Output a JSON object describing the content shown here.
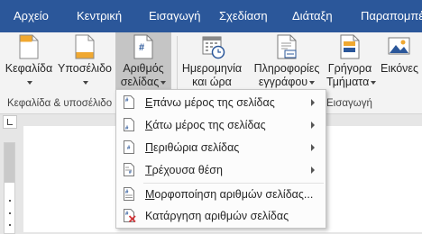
{
  "tabs": [
    {
      "label": "Αρχείο"
    },
    {
      "label": "Κεντρική"
    },
    {
      "label": "Εισαγωγή"
    },
    {
      "label": "Σχεδίαση"
    },
    {
      "label": "Διάταξη"
    },
    {
      "label": "Παραπομπές"
    }
  ],
  "ribbon": {
    "header": {
      "line1": "Κεφαλίδα"
    },
    "footer": {
      "line1": "Υποσέλιδο"
    },
    "page_number": {
      "line1": "Αριθμός",
      "line2": "σελίδας"
    },
    "date_time": {
      "line1": "Ημερομηνία",
      "line2": "και ώρα"
    },
    "doc_info": {
      "line1": "Πληροφορίες",
      "line2": "εγγράφου"
    },
    "quick_parts": {
      "line1": "Γρήγορα",
      "line2": "Τμήματα"
    },
    "pictures": {
      "line1": "Εικόνες"
    },
    "group_header_footer": "Κεφαλίδα & υποσέλιδο",
    "group_insert": "Εισαγωγή"
  },
  "menu": {
    "items": [
      {
        "prefix": "Ε",
        "rest": "πάνω μέρος της σελίδας",
        "submenu": true
      },
      {
        "prefix": "Κ",
        "rest": "άτω μέρος της σελίδας",
        "submenu": true
      },
      {
        "prefix": "Π",
        "rest": "εριθώρια σελίδας",
        "submenu": true
      },
      {
        "prefix": "Τ",
        "rest": "ρέχουσα θέση",
        "submenu": true
      },
      {
        "prefix": "Μ",
        "rest": "ορφοποίηση αριθμών σελίδας...",
        "submenu": false
      },
      {
        "prefix": "",
        "rest": "Κατάργηση αριθμών σελίδας",
        "submenu": false
      }
    ]
  },
  "colors": {
    "accent": "#2b579a",
    "pressed": "#c5c5c5",
    "remove_red": "#d13438"
  }
}
